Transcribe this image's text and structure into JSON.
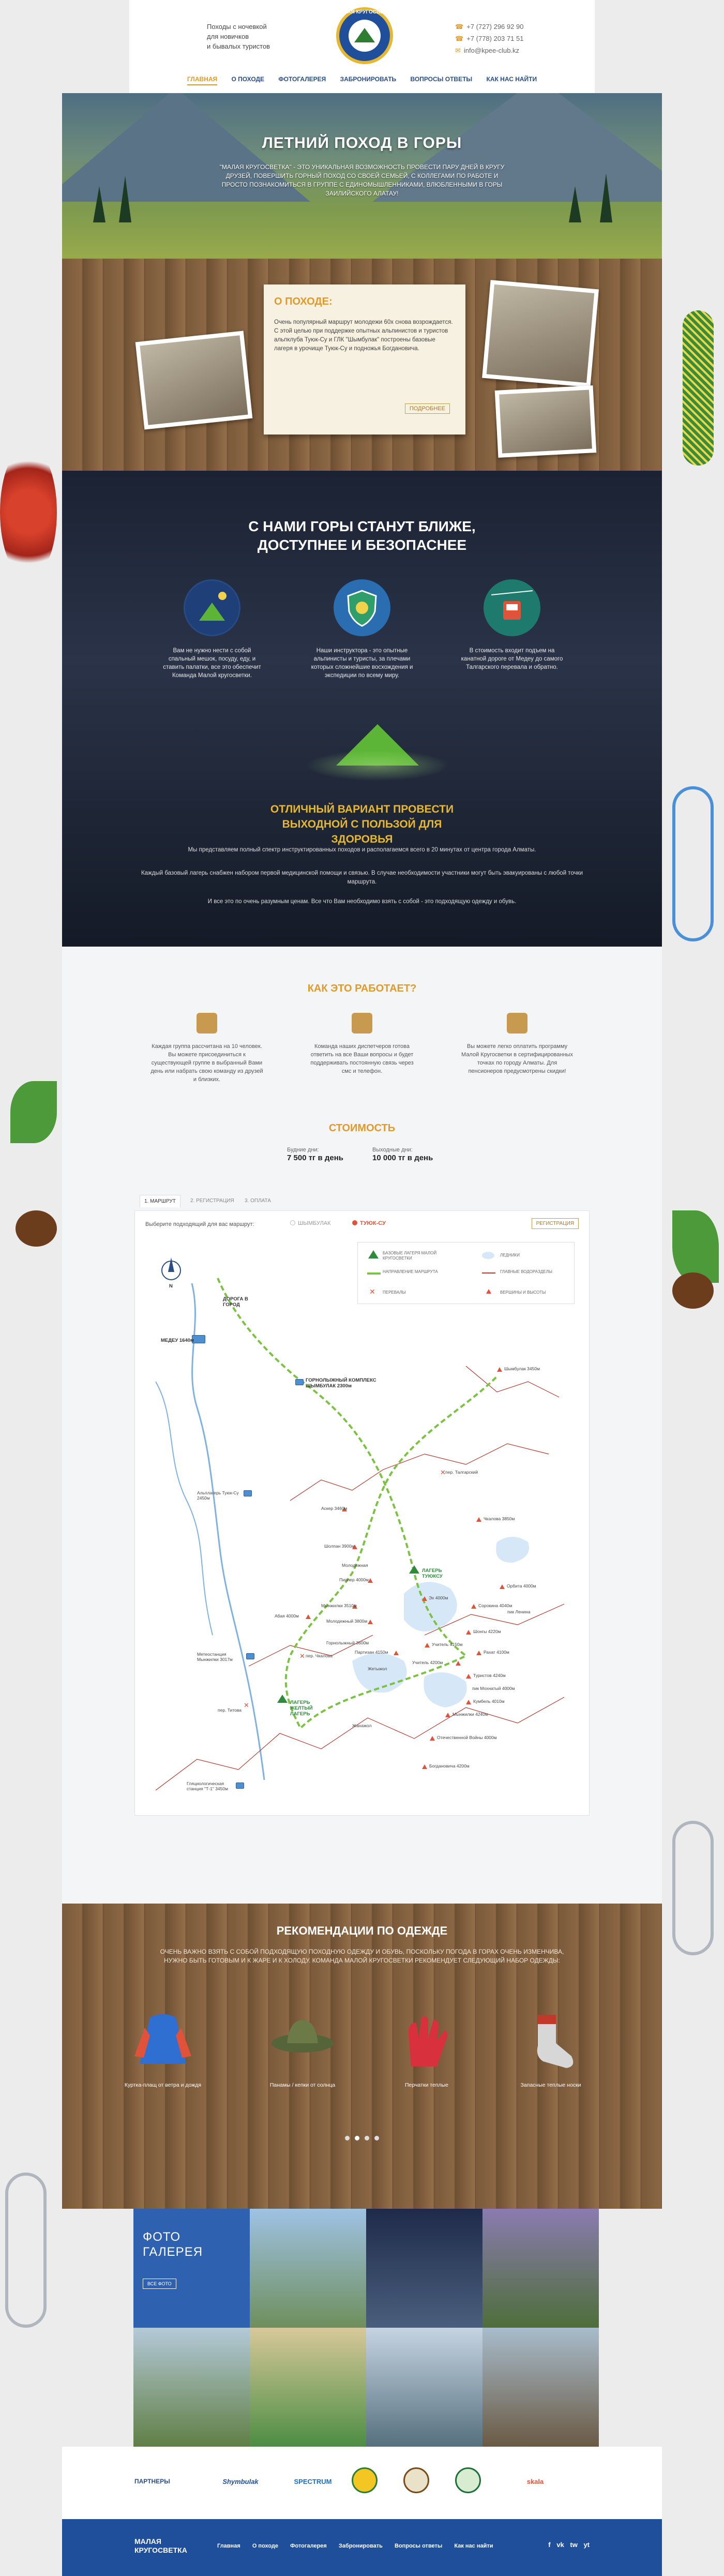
{
  "header": {
    "tagline": [
      "Походы с ночевкой",
      "для новичков",
      "и бывалых туристов"
    ],
    "logo_text": "МАЛАЯ КРУГОСВЕТКА",
    "phones": [
      "+7 (727) 296 92 90",
      "+7 (778) 203 71 51"
    ],
    "email": "info@kpee-club.kz",
    "nav": [
      "ГЛАВНАЯ",
      "О ПОХОДЕ",
      "ФОТОГАЛЕРЕЯ",
      "ЗАБРОНИРОВАТЬ",
      "ВОПРОСЫ ОТВЕТЫ",
      "КАК НАС НАЙТИ"
    ]
  },
  "hero": {
    "title": "ЛЕТНИЙ ПОХОД В ГОРЫ",
    "text": "\"МАЛАЯ КРУГОСВЕТКА\" - ЭТО УНИКАЛЬНАЯ ВОЗМОЖНОСТЬ ПРОВЕСТИ ПАРУ ДНЕЙ В КРУГУ ДРУЗЕЙ, ПОВЕРШИТЬ ГОРНЫЙ ПОХОД СО СВОЕЙ СЕМЬЕЙ, С КОЛЛЕГАМИ ПО РАБОТЕ И ПРОСТО ПОЗНАКОМИТЬСЯ В ГРУППЕ С ЕДИНОМЫШЛЕННИКАМИ, ВЛЮБЛЕННЫМИ В ГОРЫ ЗАИЛИЙСКОГО АЛАТАУ!"
  },
  "about": {
    "title": "О ПОХОДЕ:",
    "text": "Очень популярный маршрут молодежи 60х снова возрождается. С этой целью при поддержке опытных альпинистов и туристов альпклуба Туюк-Су и ГЛК \"Шымбулак\" построены базовые лагеря в урочище Туюк-Су и подножья Богдановича.",
    "button": "ПОДРОБНЕЕ"
  },
  "night": {
    "title": "С НАМИ ГОРЫ СТАНУТ БЛИЖЕ, ДОСТУПНЕЕ И БЕЗОПАСНЕЕ",
    "features": [
      {
        "icon": "camp-night-icon",
        "text": "Вам не нужно нести с собой спальный мешок, посуду, еду, и ставить палатки, все это обеспечит Команда Малой кругосветки."
      },
      {
        "icon": "shield-instructor-icon",
        "text": "Наши инструктора - это опытные альпинисты и туристы, за плечами которых сложнейшие восхождения и экспедиции по всему миру."
      },
      {
        "icon": "cable-car-icon",
        "text": "В стоимость входит подъем на канатной дороге от Медеу до самого Талгарского перевала и обратно."
      }
    ],
    "subtitle": "ОТЛИЧНЫЙ ВАРИАНТ ПРОВЕСТИ ВЫХОДНОЙ С ПОЛЬЗОЙ ДЛЯ ЗДОРОВЬЯ",
    "paragraphs": [
      "Мы представляем полный спектр инструктированных походов и располагаемся всего в 20 минутах от центра города Алматы.",
      "Каждый базовый лагерь снабжен набором первой медицинской помощи и связью. В случае необходимости участники могут быть эвакуированы с любой точки маршрута.",
      "И все это по очень разумным ценам. Все что Вам необходимо взять с собой - это подходящую одежду и обувь."
    ]
  },
  "how": {
    "title": "КАК ЭТО РАБОТАЕТ?",
    "items": [
      {
        "icon": "hiker-icon",
        "text": "Каждая группа рассчитана на 10 человек. Вы можете присоединиться к существующей группе в выбранный Вами день или набрать свою команду из друзей и близких."
      },
      {
        "icon": "team-icon",
        "text": "Команда наших диспетчеров готова ответить на все Ваши вопросы и будет поддерживать постоянную связь через смс и телефон."
      },
      {
        "icon": "cash-icon",
        "text": "Вы можете легко оплатить программу Малой Кругосветки в сертифицированных точках по городу Алматы. Для пенсионеров предусмотрены скидки!"
      }
    ]
  },
  "price": {
    "title": "СТОИМОСТЬ",
    "weekdays_label": "Будние дни:",
    "weekdays": "7 500 тг в день",
    "weekends_label": "Выходные дни:",
    "weekends": "10 000 тг в день"
  },
  "route": {
    "tabs": [
      "1. МАРШРУТ",
      "2. РЕГИСТРАЦИЯ",
      "3. ОПЛАТА"
    ],
    "prompt": "Выберите подходящий для вас маршрут:",
    "options": [
      "ШЫМБУЛАК",
      "ТУЮК-СУ"
    ],
    "selected": "ТУЮК-СУ",
    "register": "РЕГИСТРАЦИЯ",
    "legend": [
      "БАЗОВЫЕ ЛАГЕРЯ МАЛОЙ КРУГОСВЕТКИ",
      "ЛЕДНИКИ",
      "НАПРАВЛЕНИЕ МАРШРУТА",
      "ГЛАВНЫЕ ВОДОРАЗДЕЛЫ",
      "ПЕРЕВАЛЫ",
      "ВЕРШИНЫ И ВЫСОТЫ"
    ],
    "places": {
      "city": "ДОРОГА В ГОРОД",
      "medeu": "МЕДЕУ 1640м",
      "complex": "ГОРНОЛЫЖНЫЙ КОМПЛЕКС ШЫМБУЛАК 2300м",
      "camp1": "ЛАГЕРЬ ЖЕЛТЫЙ ЛАГЕРЬ",
      "camp2": "ЛАГЕРЬ ТУЮКСУ",
      "alp": "Альплагерь Туюк-Су 2450м",
      "meteo": "Метеостанция Мынжилки 3017м",
      "station": "Гляциологическая станция \"Т-1\" 3450м"
    },
    "peaks": [
      "Шымбулак 3450м",
      "пер. Талгарский",
      "Чкалова 3850м",
      "Аскер 3460м",
      "Орбита 4000м",
      "пик Ленина",
      "Шолпан 3900м",
      "Молодежная",
      "Пионер 4000м",
      "Эх 4000м",
      "Мынжилки 3510м",
      "Молодежный 3800м",
      "Сорокина 4040м",
      "Шонгы 4220м",
      "Учитель 4150м",
      "Рахат 4100м",
      "Горнолыжный 3600м",
      "Партизан 4150м",
      "пер. Чкалова",
      "Учитель 4200м",
      "Жетыжол",
      "Туристов 4240м",
      "пик Мохнатый 4000м",
      "Кумбель 4010м",
      "Мынжилки 4240м",
      "Отечественной Войны 4000м",
      "Жанажол",
      "Богдановича 4200м",
      "Абая 4000м",
      "пер. Титова"
    ],
    "north": "N"
  },
  "clothes": {
    "title": "РЕКОМЕНДАЦИИ ПО ОДЕЖДЕ",
    "text": "ОЧЕНЬ ВАЖНО ВЗЯТЬ С СОБОЙ ПОДХОДЯЩУЮ ПОХОДНУЮ ОДЕЖДУ И ОБУВЬ, ПОСКОЛЬКУ ПОГОДА В ГОРАХ ОЧЕНЬ ИЗМЕНЧИВА, НУЖНО БЫТЬ ГОТОВЫМ И К ЖАРЕ И К ХОЛОДУ. КОМАНДА МАЛОЙ КРУГОСВЕТКИ РЕКОМЕНДУЕТ СЛЕДУЮЩИЙ НАБОР ОДЕЖДЫ:",
    "items": [
      {
        "icon": "raincoat-icon",
        "label": "Куртка-плащ от ветра и дождя"
      },
      {
        "icon": "hat-icon",
        "label": "Панамы / кепки от солнца"
      },
      {
        "icon": "gloves-icon",
        "label": "Перчатки теплые"
      },
      {
        "icon": "socks-icon",
        "label": "Запасные теплые носки"
      }
    ]
  },
  "gallery": {
    "title": [
      "ФОТО",
      "ГАЛЕРЕЯ"
    ],
    "button": "ВСЕ ФОТО"
  },
  "partners": {
    "label": "ПАРТНЕРЫ",
    "logos": [
      "Shymbulak",
      "SPECTRUM",
      "partner-3",
      "partner-4",
      "partner-5",
      "skala"
    ]
  },
  "footer": {
    "logo": [
      "МАЛАЯ",
      "КРУГОСВЕТКА"
    ],
    "nav": [
      "Главная",
      "О походе",
      "Фотогалерея",
      "Забронировать",
      "Вопросы ответы",
      "Как нас найти"
    ],
    "social": [
      "f",
      "vk",
      "tw",
      "yt"
    ]
  },
  "colors": {
    "accent": "#e09a2a",
    "brand": "#1f4f9a",
    "route": "#e0533a"
  }
}
